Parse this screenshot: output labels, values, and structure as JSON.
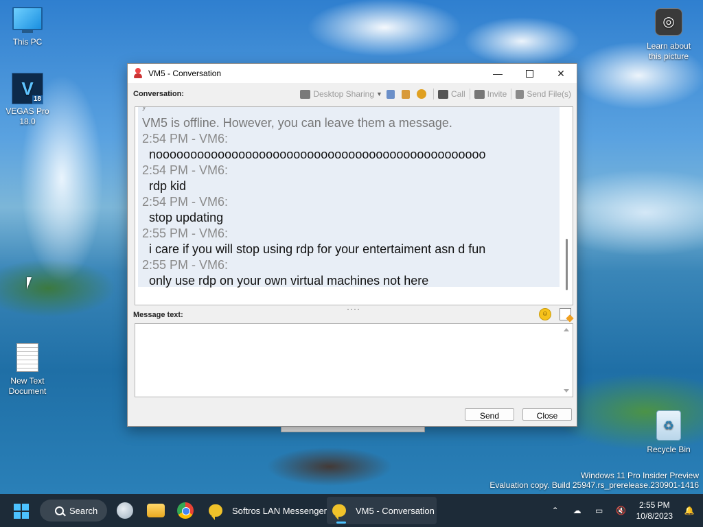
{
  "desktop": {
    "icons": {
      "this_pc": "This PC",
      "vegas_line1": "VEGAS Pro",
      "vegas_line2": "18.0",
      "vegas_badge": "18",
      "vegas_glyph": "V",
      "new_text_line1": "New Text",
      "new_text_line2": "Document",
      "learn_line1": "Learn about",
      "learn_line2": "this picture",
      "recycle_bin": "Recycle Bin"
    },
    "watermark": {
      "line1": "Windows 11 Pro Insider Preview",
      "line2": "Evaluation copy. Build 25947.rs_prerelease.230901-1416"
    }
  },
  "window": {
    "title": "VM5 - Conversation",
    "conversation_label": "Conversation:",
    "toolbar": {
      "desktop_sharing": "Desktop Sharing",
      "call": "Call",
      "invite": "Invite",
      "send_files": "Send File(s)"
    },
    "chat_lines": [
      {
        "kind": "meta",
        "text": "y"
      },
      {
        "kind": "offline",
        "text": "VM5 is offline. However, you can leave them a message."
      },
      {
        "kind": "meta",
        "text": "2:54 PM - VM6:"
      },
      {
        "kind": "msg",
        "text": "noooooooooooooooooooooooooooooooooooooooooooooooo"
      },
      {
        "kind": "meta",
        "text": "2:54 PM - VM6:"
      },
      {
        "kind": "msg",
        "text": "rdp kid"
      },
      {
        "kind": "meta",
        "text": "2:54 PM - VM6:"
      },
      {
        "kind": "msg",
        "text": "stop updating"
      },
      {
        "kind": "meta",
        "text": "2:55 PM - VM6:"
      },
      {
        "kind": "msg",
        "text": "i care if you will stop using rdp for your entertaiment asn d fun"
      },
      {
        "kind": "meta",
        "text": "2:55 PM - VM6:"
      },
      {
        "kind": "msg",
        "text": "only use rdp on your own virtual machines not here"
      }
    ],
    "splitter": "····",
    "message_label": "Message text:",
    "message_value": "",
    "send_label": "Send",
    "close_label": "Close"
  },
  "taskbar": {
    "search_label": "Search",
    "task_messenger": "Softros LAN Messenger",
    "task_conversation": "VM5 - Conversation",
    "time": "2:55 PM",
    "date": "10/8/2023"
  },
  "colors": {
    "taskbar_bg": "#1d2b38",
    "accent": "#4cc2ff",
    "chat_bg": "#e8eef6"
  }
}
